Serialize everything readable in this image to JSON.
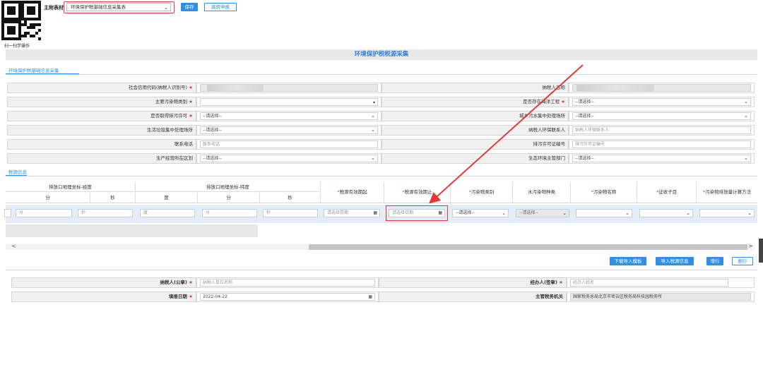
{
  "topbar": {
    "qr_caption": "扫一扫学操作",
    "main_table_label": "主附表材",
    "main_table_value": "环境保护税基础信息采集表",
    "save_label": "保存",
    "jump_label": "跳转申报"
  },
  "header": {
    "title": "环境保护税税源采集"
  },
  "tabs": {
    "basic": "环境保护税基础信息采集",
    "source": "税源信息"
  },
  "form": {
    "credit_code_label": "社会信用代码(纳税人识别号)",
    "taxpayer_name_label": "纳税人名称",
    "main_pollutant_label": "主要污染物类别",
    "ocean_project_label": "是否存在海洋工程",
    "ocean_project_value": "--请选择--",
    "permit_label": "是否取得排污许可",
    "permit_value": "--请选择--",
    "urban_sewage_label": "城乡污水集中处理场所",
    "urban_sewage_value": "--请选择--",
    "waste_label": "生活垃圾集中处理场所",
    "waste_value": "--请选择--",
    "env_contact_label": "纳税人环保联系人",
    "env_contact_placeholder": "纳税人环保联系人",
    "phone_label": "联系电话",
    "phone_placeholder": "联系电话",
    "permit_no_label": "排污许可证编号",
    "permit_no_placeholder": "排污许可证编号",
    "district_label": "生产经营所在区划",
    "district_value": "--请选择--",
    "eco_dept_label": "生态环境主管部门",
    "eco_dept_value": "--请选择--"
  },
  "table": {
    "group_lng": "排放口地理坐标-经度",
    "group_lat": "排放口地理坐标-纬度",
    "sub_fen": "分",
    "sub_miao": "秒",
    "sub_du": "度",
    "col_start": "税源有效期起",
    "col_end": "税源有效期止",
    "col_pollutant_type": "污染物类别",
    "col_water_type": "水污染物种类",
    "col_pollutant_name": "污染物名称",
    "col_levy_item": "征收子目",
    "col_calc_method": "污染物排放量计算方法",
    "row": {
      "fen": "分",
      "miao": "秒",
      "du": "度",
      "fen2": "分",
      "miao2": "秒",
      "date_start": "请选择日期",
      "date_end": "请选择日期",
      "pollutant_type": "--请选择--",
      "water_type": "--请选择--"
    }
  },
  "actions": {
    "download_template": "下载导入模板",
    "import_source": "导入税源信息",
    "add_row": "增行",
    "delete_row": "删行"
  },
  "footer": {
    "taxpayer_seal_label": "纳税人(公章)",
    "taxpayer_seal_placeholder": "纳税人单位名称",
    "agent_label": "经办人(签章)",
    "agent_placeholder": "经办人姓名",
    "fill_date_label": "填报日期",
    "fill_date_value": "2022-04-22",
    "tax_authority_label": "主管税务机关",
    "tax_authority_value": "国家税务总局北京市密云区税务局科技园税务所"
  },
  "colors": {
    "accent": "#2f8fe4",
    "highlight": "#e53935",
    "header_bg": "#e8e8e8"
  }
}
